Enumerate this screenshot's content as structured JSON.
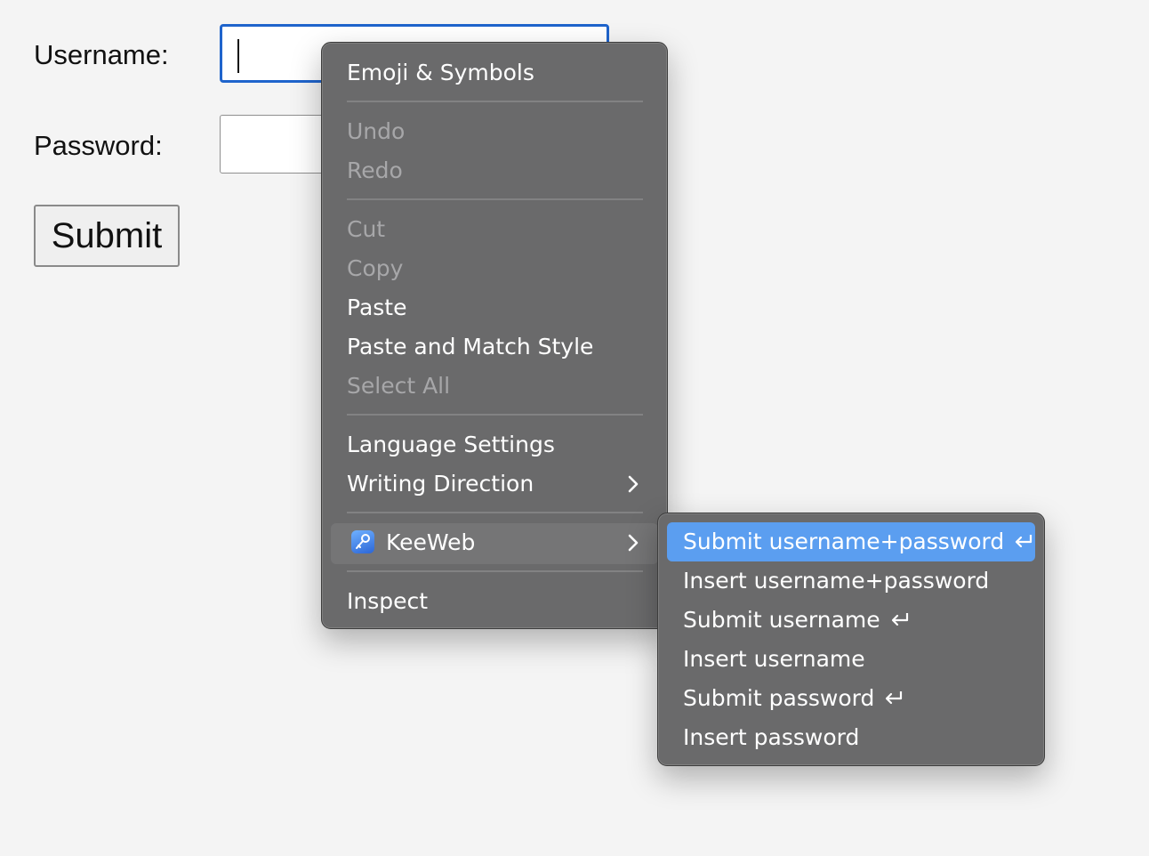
{
  "form": {
    "username_label": "Username:",
    "password_label": "Password:",
    "username_value": "",
    "password_value": "",
    "submit_label": "Submit"
  },
  "context_menu": {
    "items": [
      {
        "label": "Emoji & Symbols",
        "enabled": true
      },
      {
        "label": "Undo",
        "enabled": false
      },
      {
        "label": "Redo",
        "enabled": false
      },
      {
        "label": "Cut",
        "enabled": false
      },
      {
        "label": "Copy",
        "enabled": false
      },
      {
        "label": "Paste",
        "enabled": true
      },
      {
        "label": "Paste and Match Style",
        "enabled": true
      },
      {
        "label": "Select All",
        "enabled": false
      },
      {
        "label": "Language Settings",
        "enabled": true
      },
      {
        "label": "Writing Direction",
        "enabled": true,
        "submenu": true
      },
      {
        "label": "KeeWeb",
        "enabled": true,
        "submenu": true,
        "icon": "keeweb-key-icon"
      },
      {
        "label": "Inspect",
        "enabled": true
      }
    ]
  },
  "keeweb_submenu": {
    "items": [
      {
        "label": "Submit username+password",
        "enter_icon": true,
        "selected": true
      },
      {
        "label": "Insert username+password",
        "enter_icon": false
      },
      {
        "label": "Submit username",
        "enter_icon": true
      },
      {
        "label": "Insert username",
        "enter_icon": false
      },
      {
        "label": "Submit password",
        "enter_icon": true
      },
      {
        "label": "Insert password",
        "enter_icon": false
      }
    ]
  },
  "colors": {
    "page_bg": "#f4f4f4",
    "focus_ring": "#1f64cc",
    "menu_bg": "#6a6a6b",
    "menu_highlight": "#5b9ef0",
    "disabled_text": "#a7a7a9"
  }
}
